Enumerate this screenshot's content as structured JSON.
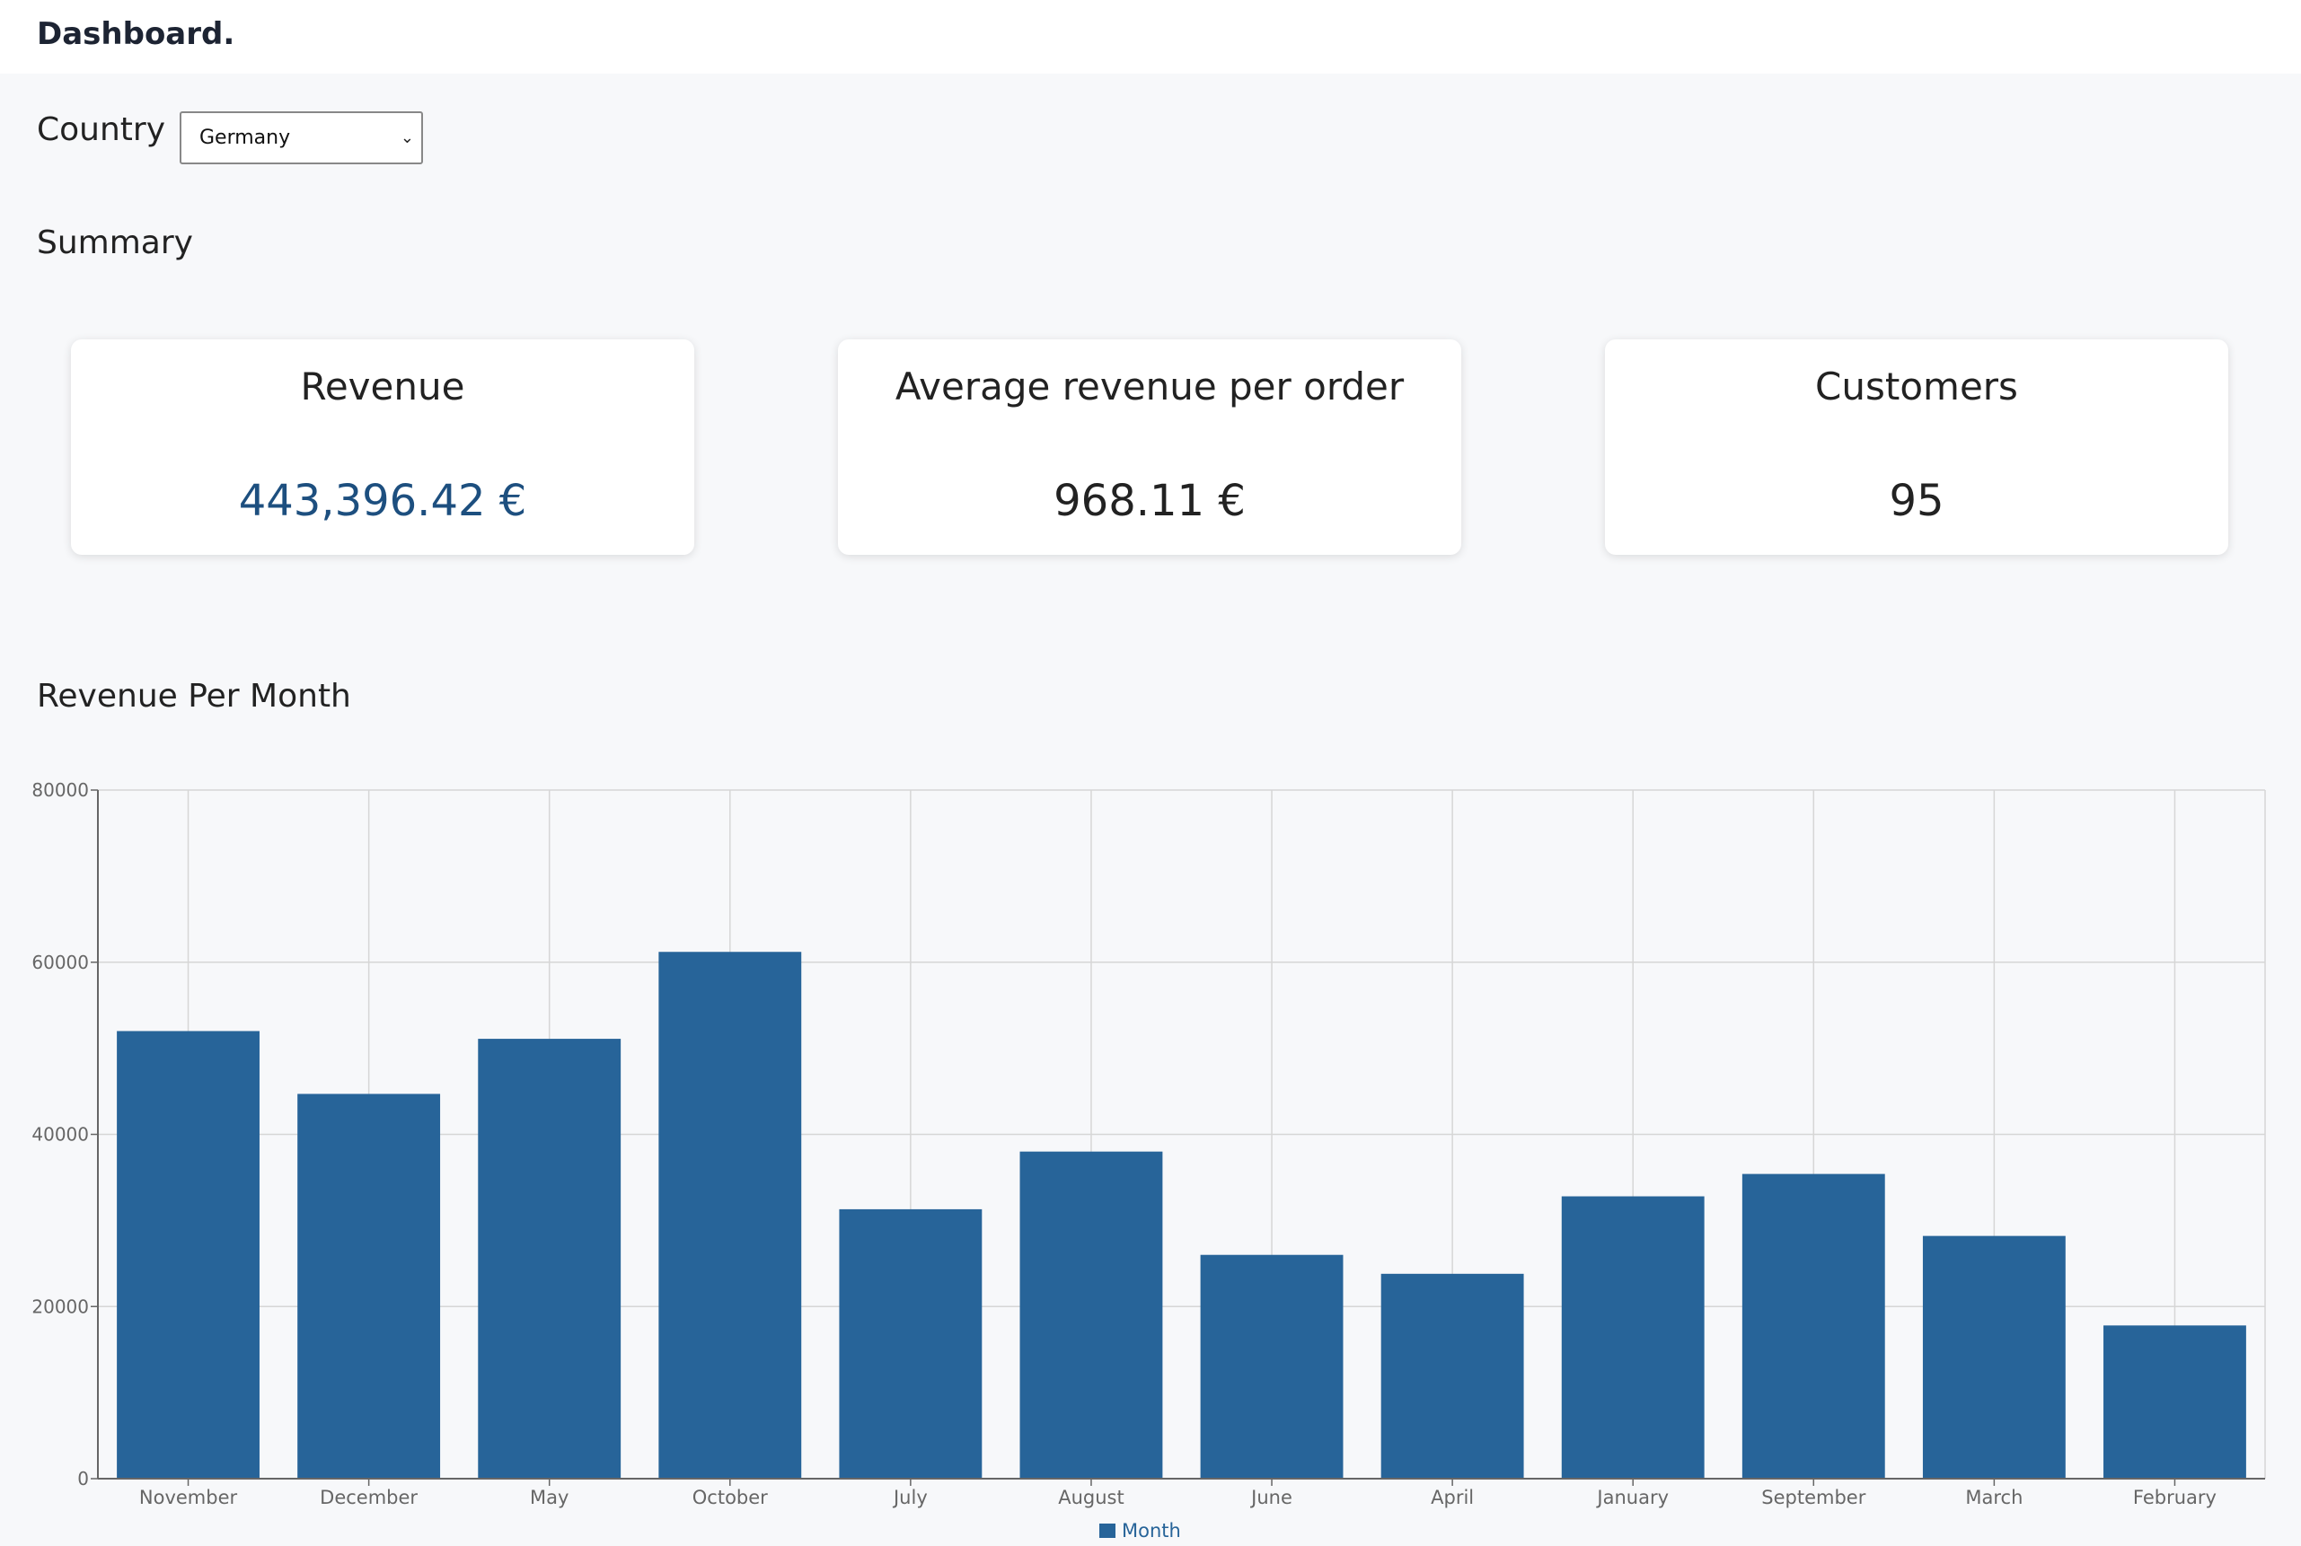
{
  "header": {
    "brand": "Dashboard."
  },
  "filter": {
    "label": "Country",
    "selected": "Germany"
  },
  "summary": {
    "title": "Summary",
    "cards": [
      {
        "title": "Revenue",
        "value": "443,396.42 €"
      },
      {
        "title": "Average revenue per order",
        "value": "968.11 €"
      },
      {
        "title": "Customers",
        "value": "95"
      }
    ]
  },
  "colors": {
    "accent": "#1d4f7f",
    "bar": "#276499",
    "grid": "#d6d6d6"
  },
  "chart_section": {
    "title": "Revenue Per Month"
  },
  "chart_data": {
    "type": "bar",
    "categories": [
      "November",
      "December",
      "May",
      "October",
      "July",
      "August",
      "June",
      "April",
      "January",
      "September",
      "March",
      "February"
    ],
    "series": [
      {
        "name": "Month",
        "values": [
          52000,
          44700,
          51100,
          61200,
          31300,
          38000,
          26000,
          23800,
          32800,
          35400,
          28200,
          17800
        ]
      }
    ],
    "ylim": [
      0,
      80000
    ],
    "yticks": [
      0,
      20000,
      40000,
      60000,
      80000
    ],
    "grid": true,
    "legend": "bottom-center"
  }
}
